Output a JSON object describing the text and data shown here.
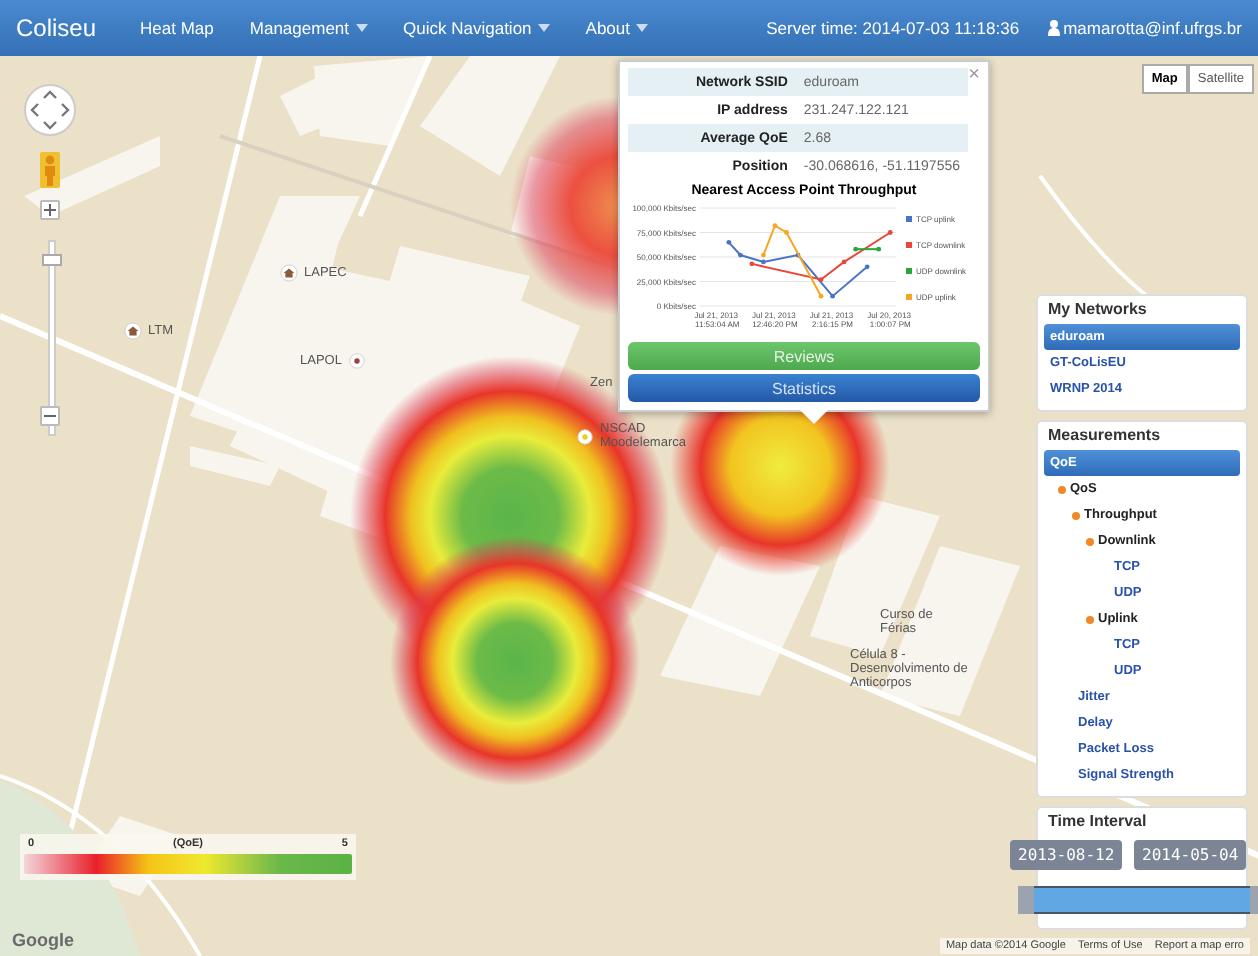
{
  "navbar": {
    "brand": "Coliseu",
    "items": [
      {
        "label": "Heat Map",
        "dropdown": false
      },
      {
        "label": "Management",
        "dropdown": true
      },
      {
        "label": "Quick Navigation",
        "dropdown": true
      },
      {
        "label": "About",
        "dropdown": true
      }
    ],
    "server_time": "Server time: 2014-07-03 11:18:36",
    "user": "mamarotta@inf.ufrgs.br"
  },
  "map": {
    "zoom": {
      "level": 0.93
    },
    "map_types": [
      {
        "label": "Map",
        "selected": true
      },
      {
        "label": "Satellite",
        "selected": false
      }
    ],
    "places": [
      {
        "label": "LAPEC",
        "kind": "building"
      },
      {
        "label": "LTM",
        "kind": "building"
      },
      {
        "label": "LAPOL",
        "kind": "dot"
      },
      {
        "label": "Zen",
        "kind": "text"
      },
      {
        "label": "NSCAD Moodelemarca",
        "kind": "dot"
      },
      {
        "label": "Curso de Férias",
        "kind": "text"
      },
      {
        "label": "Célula 8 - Desenvolvimento de Anticorpos",
        "kind": "text"
      }
    ],
    "legend": {
      "min": "0",
      "title": "(QoE)",
      "max": "5"
    },
    "attribution": {
      "logo": "Google",
      "data": "Map data ©2014 Google",
      "terms": "Terms of Use",
      "report": "Report a map erro"
    }
  },
  "popup": {
    "close": "×",
    "fields": [
      {
        "label": "Network SSID",
        "value": "eduroam"
      },
      {
        "label": "IP address",
        "value": "231.247.122.121"
      },
      {
        "label": "Average QoE",
        "value": "2.68"
      },
      {
        "label": "Position",
        "value": "-30.068616, -51.1197556"
      }
    ],
    "chart_data": {
      "type": "line",
      "title": "Nearest Access Point Throughput",
      "ylim": [
        0,
        100000
      ],
      "grid": true,
      "legend": "right",
      "categories": [
        null,
        "Jul 21, 2013 11:53:04 AM",
        null,
        null,
        null,
        null,
        "Jul 21, 2013 12:46:20 PM",
        null,
        null,
        null,
        null,
        "Jul 21, 2013 2:16:15 PM",
        null,
        null,
        null,
        null,
        "Jul 20, 2013 1:00:07 PM"
      ],
      "yticks": [
        {
          "value": 0,
          "label": "0 Kbits/sec"
        },
        {
          "value": 25000,
          "label": "25,000 Kbits/sec"
        },
        {
          "value": 50000,
          "label": "50,000 Kbits/sec"
        },
        {
          "value": 75000,
          "label": "75,000 Kbits/sec"
        },
        {
          "value": 100000,
          "label": "100,000 Kbits/sec"
        }
      ],
      "series": [
        {
          "name": "TCP uplink",
          "color": "#4a74c9",
          "values": [
            null,
            null,
            65000,
            52000,
            null,
            45000,
            null,
            null,
            52000,
            null,
            null,
            10000,
            null,
            null,
            40000,
            null,
            null
          ]
        },
        {
          "name": "TCP downlink",
          "color": "#e8483a",
          "values": [
            null,
            null,
            null,
            null,
            43000,
            null,
            null,
            null,
            null,
            null,
            27000,
            null,
            45000,
            null,
            null,
            null,
            75000
          ]
        },
        {
          "name": "UDP downlink",
          "color": "#2aa63a",
          "values": [
            null,
            null,
            null,
            null,
            null,
            null,
            null,
            null,
            null,
            null,
            null,
            null,
            null,
            58000,
            null,
            58000,
            null
          ]
        },
        {
          "name": "UDP uplink",
          "color": "#f5a623",
          "values": [
            null,
            null,
            null,
            null,
            null,
            52000,
            82000,
            75000,
            null,
            null,
            10000,
            null,
            null,
            null,
            null,
            null,
            null
          ]
        }
      ]
    },
    "buttons": [
      {
        "label": "Reviews",
        "kind": "success"
      },
      {
        "label": "Statistics",
        "kind": "primary"
      }
    ]
  },
  "panel": {
    "networks_title": "My Networks",
    "networks": [
      {
        "label": "eduroam",
        "selected": true
      },
      {
        "label": "GT-CoLisEU",
        "selected": false
      },
      {
        "label": "WRNP 2014",
        "selected": false
      }
    ],
    "measurements_title": "Measurements",
    "measurements": [
      {
        "label": "QoE",
        "selected": true,
        "children": [
          {
            "label": "QoS",
            "selected": false,
            "children": [
              {
                "label": "Throughput",
                "selected": false,
                "children": [
                  {
                    "label": "Downlink",
                    "selected": false,
                    "children": [
                      {
                        "label": "TCP",
                        "selected": false
                      },
                      {
                        "label": "UDP",
                        "selected": false
                      }
                    ]
                  },
                  {
                    "label": "Uplink",
                    "selected": false,
                    "children": [
                      {
                        "label": "TCP",
                        "selected": false
                      },
                      {
                        "label": "UDP",
                        "selected": false
                      }
                    ]
                  }
                ]
              },
              {
                "label": "Jitter",
                "selected": false
              },
              {
                "label": "Delay",
                "selected": false
              },
              {
                "label": "Packet Loss",
                "selected": false
              },
              {
                "label": "Signal Strength",
                "selected": false
              }
            ]
          }
        ]
      }
    ],
    "time_title": "Time Interval",
    "time_range": {
      "start": {
        "label": "2013-08-12",
        "level": 0.0
      },
      "end": {
        "label": "2014-05-04",
        "level": 1.0
      }
    }
  }
}
